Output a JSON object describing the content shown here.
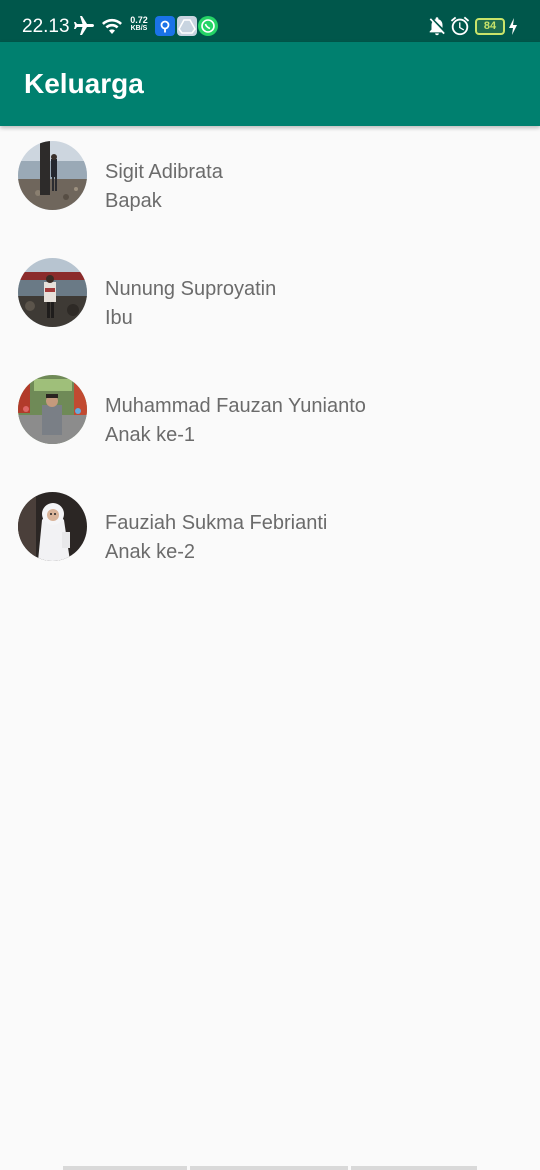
{
  "status_bar": {
    "time": "22.13",
    "net_speed_value": "0.72",
    "net_speed_unit": "KB/S",
    "battery_level": "84",
    "icons": [
      "airplane-mode-icon",
      "wifi-icon",
      "app-notification-icon",
      "drive-notification-icon",
      "whatsapp-icon",
      "notifications-off-icon",
      "alarm-icon",
      "battery-icon",
      "charging-icon"
    ]
  },
  "app_bar": {
    "title": "Keluarga"
  },
  "members": [
    {
      "name": "Sigit Adibrata",
      "role": "Bapak"
    },
    {
      "name": "Nunung Suproyatin",
      "role": "Ibu"
    },
    {
      "name": "Muhammad Fauzan Yunianto",
      "role": "Anak ke-1"
    },
    {
      "name": "Fauziah Sukma Febrianti",
      "role": "Anak ke-2"
    }
  ],
  "colors": {
    "status_bar": "#00574b",
    "app_bar": "#00806f",
    "background": "#fafafa",
    "list_text": "#6b6b6b"
  }
}
